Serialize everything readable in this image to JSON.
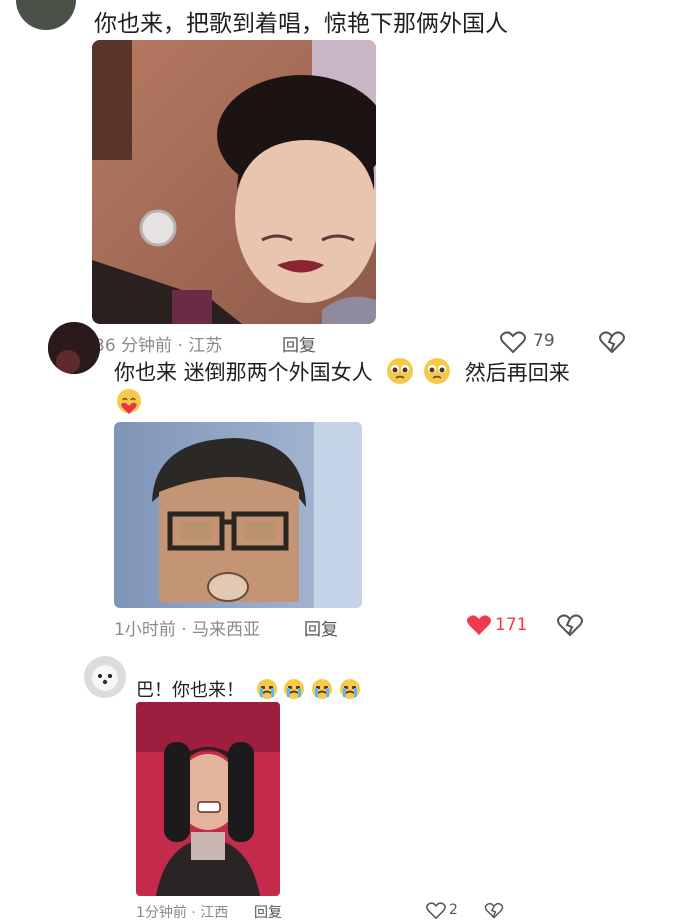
{
  "comments": [
    {
      "text": "你也来，把歌到着唱，惊艳下那俩外国人",
      "time_location": "36 分钟前 · 江苏",
      "reply_label": "回复",
      "likes": "79",
      "image_icon": "meme-photo"
    },
    {
      "text_part1": "你也来 迷倒那两个外国女人",
      "text_part2": "然后再回来",
      "emoji_inline": [
        "pleading-face-emoji",
        "pleading-face-emoji"
      ],
      "emoji_line2": "heart-hands-face-emoji",
      "time_location": "1小时前 · 马来西亚",
      "reply_label": "回复",
      "likes": "171",
      "liked": true,
      "image_icon": "meme-photo"
    },
    {
      "text": "巴！你也来！",
      "emoji_row": [
        "crying-face-emoji",
        "crying-face-emoji",
        "crying-face-emoji",
        "crying-face-emoji"
      ],
      "time_location": "1分钟前 · 江西",
      "reply_label": "回复",
      "likes": "2",
      "image_icon": "meme-photo"
    }
  ],
  "colors": {
    "liked_heart": "#f0384f",
    "meta_gray": "#8a8a8a"
  }
}
